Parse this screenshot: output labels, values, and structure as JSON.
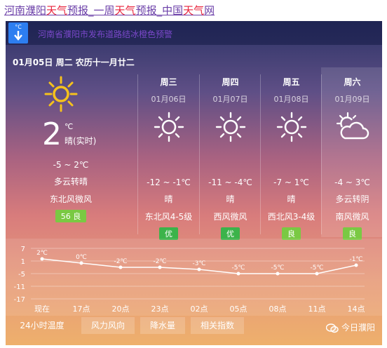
{
  "page": {
    "title_parts": [
      {
        "text": "河南濮阳",
        "hl": false
      },
      {
        "text": "天气",
        "hl": true
      },
      {
        "text": "预报_一周",
        "hl": false
      },
      {
        "text": "天气",
        "hl": true
      },
      {
        "text": "预报_中国",
        "hl": false
      },
      {
        "text": "天气",
        "hl": true
      },
      {
        "text": "网",
        "hl": false
      }
    ]
  },
  "alert": {
    "icon_label": "°C",
    "text": "河南省濮阳市发布道路结冰橙色预警"
  },
  "today": {
    "date": "01月05日 周二 农历十一月廿二",
    "temp": "2",
    "unit": "℃",
    "note": "晴(实时)",
    "range": "-5 ~ 2℃",
    "cond": "多云转晴",
    "wind": "东北风微风",
    "aqi": "56 良",
    "icon": "sun-icon"
  },
  "days": [
    {
      "week": "周三",
      "date": "01月06日",
      "icon": "sun-icon",
      "range": "-12 ~ -1℃",
      "cond": "晴",
      "wind": "东北风4-5级",
      "aqi": "优",
      "aqi_color": "#3cb34a"
    },
    {
      "week": "周四",
      "date": "01月07日",
      "icon": "sun-icon",
      "range": "-11 ~ -4℃",
      "cond": "晴",
      "wind": "西风微风",
      "aqi": "优",
      "aqi_color": "#3cb34a"
    },
    {
      "week": "周五",
      "date": "01月08日",
      "icon": "sun-icon",
      "range": "-7 ~ 1℃",
      "cond": "晴",
      "wind": "西北风3-4级",
      "aqi": "良",
      "aqi_color": "#7ac943"
    },
    {
      "week": "周六",
      "date": "01月09日",
      "icon": "partly-cloudy-icon",
      "range": "-4 ~ 3℃",
      "cond": "多云转阴",
      "wind": "南风微风",
      "aqi": "良",
      "aqi_color": "#7ac943"
    }
  ],
  "chart_data": {
    "type": "line",
    "categories": [
      "现在",
      "17点",
      "20点",
      "23点",
      "02点",
      "05点",
      "08点",
      "11点",
      "14点"
    ],
    "values": [
      2,
      0,
      -2,
      -2,
      -3,
      -5,
      -5,
      -5,
      -1
    ],
    "labels": [
      "2℃",
      "0℃",
      "-2℃",
      "-2℃",
      "-3℃",
      "-5℃",
      "-5℃",
      "-5℃",
      "-1℃"
    ],
    "y_ticks": [
      "7",
      "1",
      "-5",
      "-11",
      "-17"
    ],
    "ylim": [
      -17,
      7
    ]
  },
  "tabs": [
    "24小时温度",
    "风力风向",
    "降水量",
    "相关指数"
  ],
  "logo": {
    "text": "今日濮阳",
    "icon": "wechat-icon"
  }
}
